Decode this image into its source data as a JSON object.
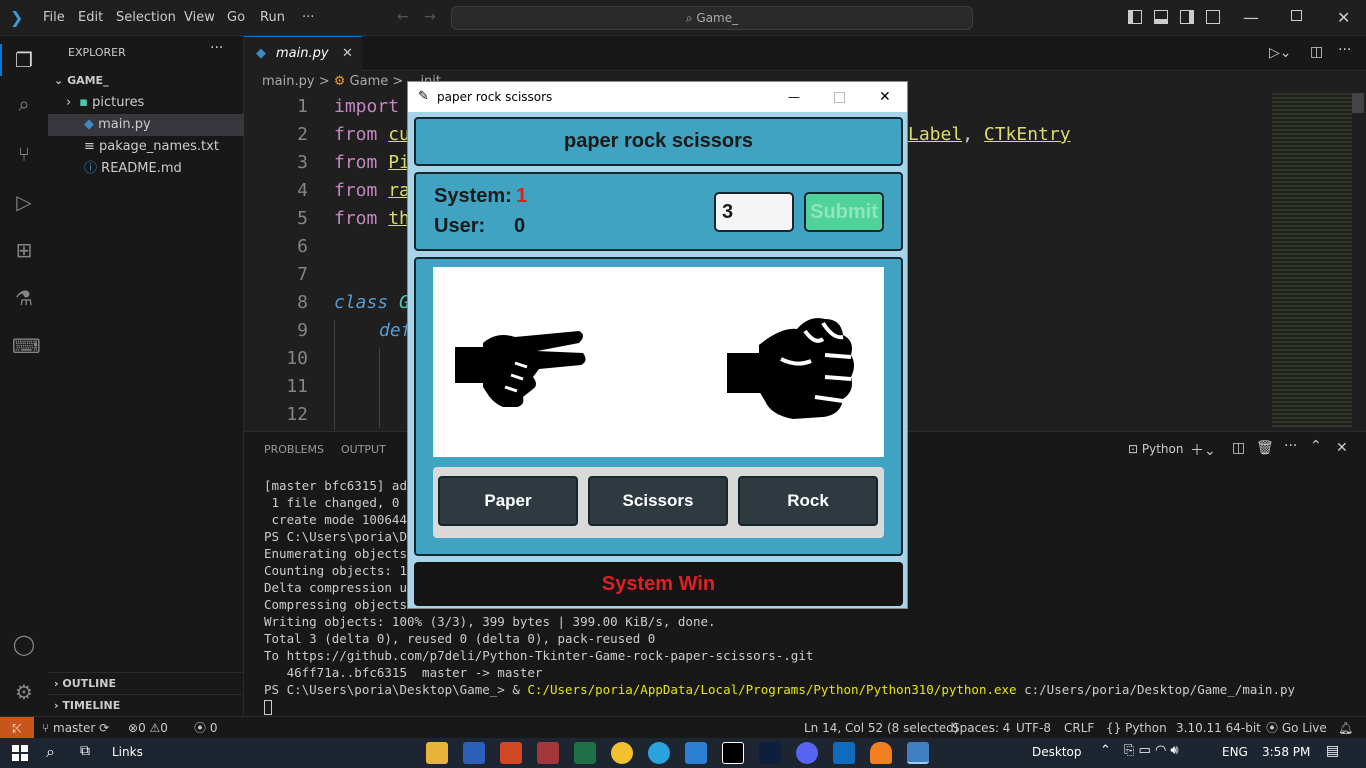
{
  "titlebar": {
    "menu": [
      "File",
      "Edit",
      "Selection",
      "View",
      "Go",
      "Run",
      "···"
    ],
    "search": "Game_"
  },
  "explorer": {
    "header": "EXPLORER",
    "folder": "GAME_",
    "items": [
      "pictures",
      "main.py",
      "pakage_names.txt",
      "README.md"
    ],
    "outline": "OUTLINE",
    "timeline": "TIMELINE"
  },
  "editor": {
    "tab": "main.py",
    "breadcrumbs": [
      "main.py",
      ">",
      "Game",
      ">",
      "__init__"
    ],
    "line_numbers": [
      "1",
      "2",
      "3",
      "4",
      "5",
      "6",
      "7",
      "8",
      "9",
      "10",
      "11",
      "12"
    ],
    "code": {
      "l1_kw": "import",
      "l2_kw": "from",
      "l2_mod": "cu",
      "l3_kw": "from",
      "l3_mod": "Pi",
      "l4_kw": "from",
      "l4_mod": "ra",
      "l5_kw": "from",
      "l5_mod": "th",
      "l8_kw": "class",
      "l8_cls": "G",
      "l9_kw": "def",
      "l2_tail_a": "Label",
      "l2_comma": ", ",
      "l2_tail_b": "CTkEntry"
    }
  },
  "panel": {
    "tabs": [
      "PROBLEMS",
      "OUTPUT"
    ],
    "shell": "Python",
    "lines": [
      "[master bfc6315] add",
      " 1 file changed, 0 in",
      " create mode 100644 p",
      "PS C:\\Users\\poria\\Des",
      "Enumerating objects:",
      "Counting objects: 100",
      "Delta compression usi",
      "Compressing objects:",
      "Writing objects: 100% (3/3), 399 bytes | 399.00 KiB/s, done.",
      "Total 3 (delta 0), reused 0 (delta 0), pack-reused 0",
      "To https://github.com/p7deli/Python-Tkinter-Game-rock-paper-scissors-.git",
      "   46ff71a..bfc6315  master -> master"
    ],
    "prompt_prefix": "PS C:\\Users\\poria\\Desktop\\Game_> & ",
    "prompt_exe": "C:/Users/poria/AppData/Local/Programs/Python/Python310/python.exe",
    "prompt_arg": " c:/Users/poria/Desktop/Game_/main.py"
  },
  "statusbar": {
    "branch": "master",
    "errors": "0",
    "warnings": "0",
    "ports": "0",
    "position": "Ln 14, Col 52 (8 selected)",
    "spaces": "Spaces: 4",
    "encoding": "UTF-8",
    "eol": "CRLF",
    "language": "Python",
    "interpreter": "3.10.11 64-bit",
    "golive": "Go Live"
  },
  "taskbar": {
    "links": "Links",
    "desktop": "Desktop",
    "lang": "ENG",
    "time": "3:58 PM"
  },
  "app": {
    "title": "paper rock scissors",
    "heading": "paper rock scissors",
    "system_label": "System:",
    "system_score": "1",
    "user_label": "User:",
    "user_score": "0",
    "entry_value": "3",
    "submit": "Submit",
    "buttons": [
      "Paper",
      "Scissors",
      "Rock"
    ],
    "result": "System Win",
    "colors": {
      "accent": "#3fa3c1",
      "result": "#e02020",
      "submit": "#4fd39a",
      "score_red": "#e02020"
    }
  }
}
